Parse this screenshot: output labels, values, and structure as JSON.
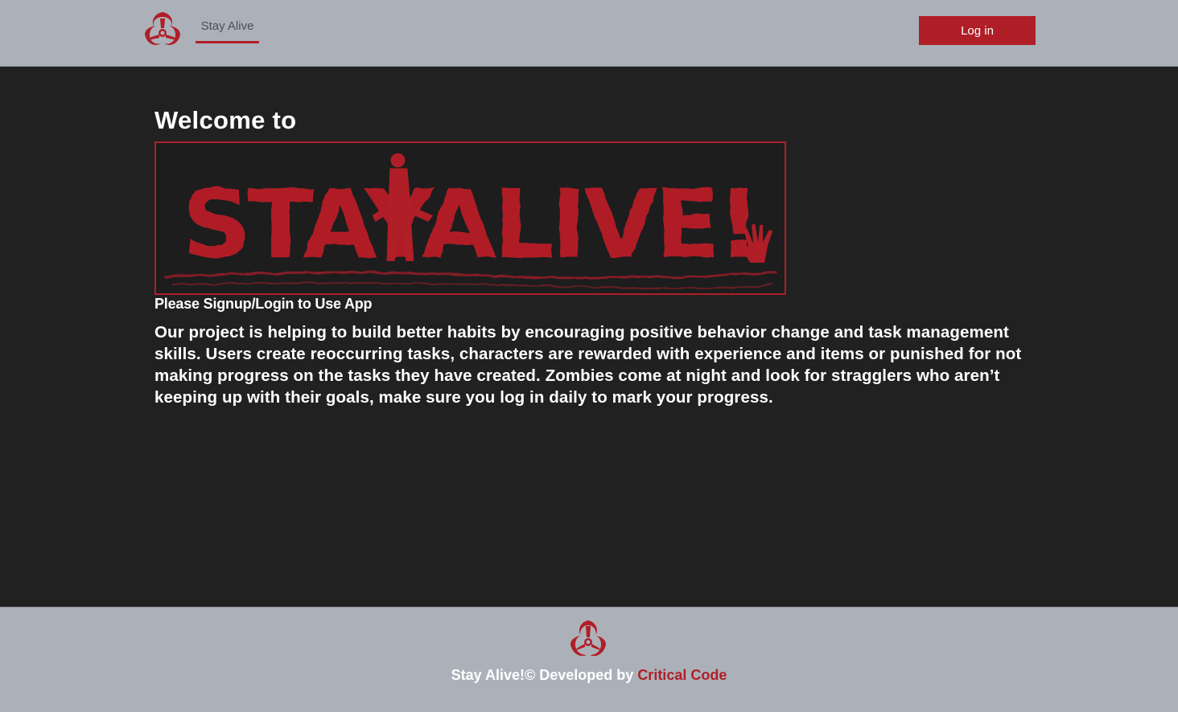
{
  "colors": {
    "accent": "#b01e28",
    "header_bg": "#acb1b9",
    "page_bg": "#212121",
    "text": "#ffffff"
  },
  "header": {
    "brand_icon": "biohazard-icon",
    "nav_tab_label": "Stay Alive",
    "login_label": "Log in"
  },
  "main": {
    "welcome_text": "Welcome to",
    "logo_text": "STAYALIVE!",
    "subtitle": "Please Signup/Login to Use App",
    "description": "Our project is helping to build better habits by encouraging positive behavior change and task management skills. Users create reoccurring tasks, characters are rewarded with experience and items or punished for not making progress on the tasks they have created. Zombies come at night and look for stragglers who aren’t keeping up with their goals, make sure you log in daily to mark your progress."
  },
  "footer": {
    "icon": "biohazard-icon",
    "text": "Stay Alive!© Developed by ",
    "link_text": "Critical Code"
  }
}
